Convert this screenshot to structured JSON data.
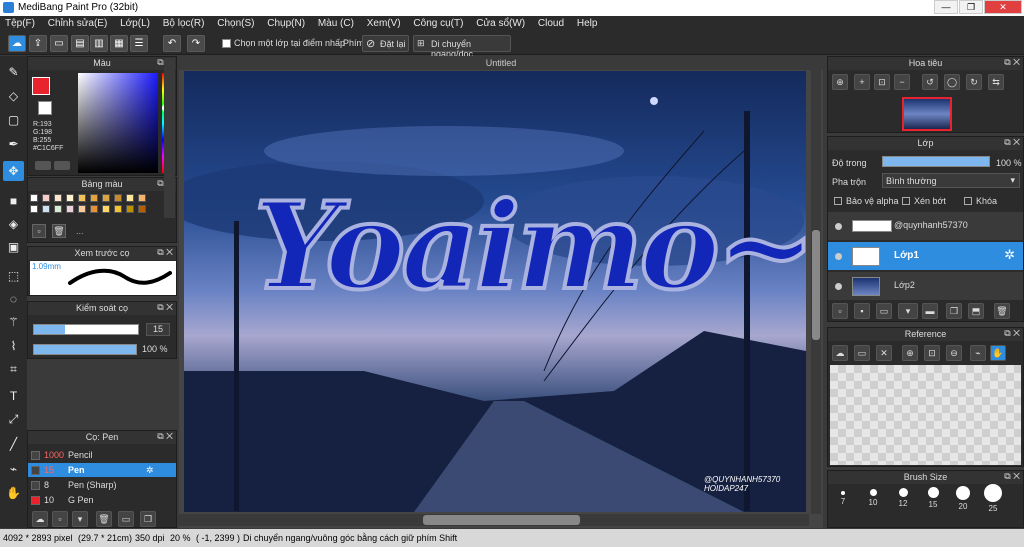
{
  "app": {
    "title": "MediBang Paint Pro (32bit)"
  },
  "menu": [
    "Tệp(F)",
    "Chỉnh sửa(E)",
    "Lớp(L)",
    "Bộ lọc(R)",
    "Chọn(S)",
    "Chụp(N)",
    "Màu (C)",
    "Xem(V)",
    "Công cụ(T)",
    "Cửa sổ(W)",
    "Cloud",
    "Help"
  ],
  "toolbar": {
    "select_layer_checkbox": "Chọn một lớp tại điểm nhấp",
    "key_label": "Phím",
    "reset_label": "Đặt lại",
    "move_label": "Di chuyển ngang/dọc"
  },
  "color_panel": {
    "title": "Màu",
    "r": "R:193",
    "g": "G:198",
    "b": "B:255",
    "hex": "#C1C6FF"
  },
  "palette_panel": {
    "title": "Bảng màu",
    "more": "..."
  },
  "brush_preview": {
    "title": "Xem trước cọ",
    "size": "1.09mm"
  },
  "brush_control": {
    "title": "Kiểm soát cọ",
    "size_value": "15",
    "opacity_value": "100 %"
  },
  "brush_list": {
    "title": "Cọ: Pen",
    "items": [
      {
        "size": "1000",
        "name": "Pencil"
      },
      {
        "size": "15",
        "name": "Pen"
      },
      {
        "size": "8",
        "name": "Pen (Sharp)"
      },
      {
        "size": "10",
        "name": "G Pen"
      }
    ]
  },
  "canvas": {
    "tab": "Untitled",
    "artwork_text": "Yoaimo~",
    "watermark_1": "@QUYNHANH57370",
    "watermark_2": "HOIDAP247"
  },
  "navigator": {
    "title": "Hoa tiêu"
  },
  "layer_panel": {
    "title": "Lớp",
    "opacity_label": "Độ trong",
    "opacity_value": "100 %",
    "blend_label": "Pha trộn",
    "blend_value": "Bình thường",
    "protect_alpha": "Bảo vệ alpha",
    "clipping": "Xén bớt",
    "lock": "Khóa",
    "layers": [
      "@quynhanh57370",
      "Lớp1",
      "Lớp2"
    ]
  },
  "reference_panel": {
    "title": "Reference"
  },
  "brush_size_panel": {
    "title": "Brush Size",
    "sizes": [
      "7",
      "10",
      "12",
      "15",
      "20",
      "25"
    ]
  },
  "status": {
    "dims": "4092 * 2893 pixel",
    "cm": "(29.7 * 21cm)",
    "dpi": "350 dpi",
    "zoom": "20 %",
    "coords": "( -1, 2399 )",
    "hint": "Di chuyển ngang/vuông góc bằng cách giữ phím Shift"
  },
  "colors": {
    "accent": "#2f8de0",
    "foreground": "#e8232d",
    "panel_bg": "#2b2b2b"
  }
}
